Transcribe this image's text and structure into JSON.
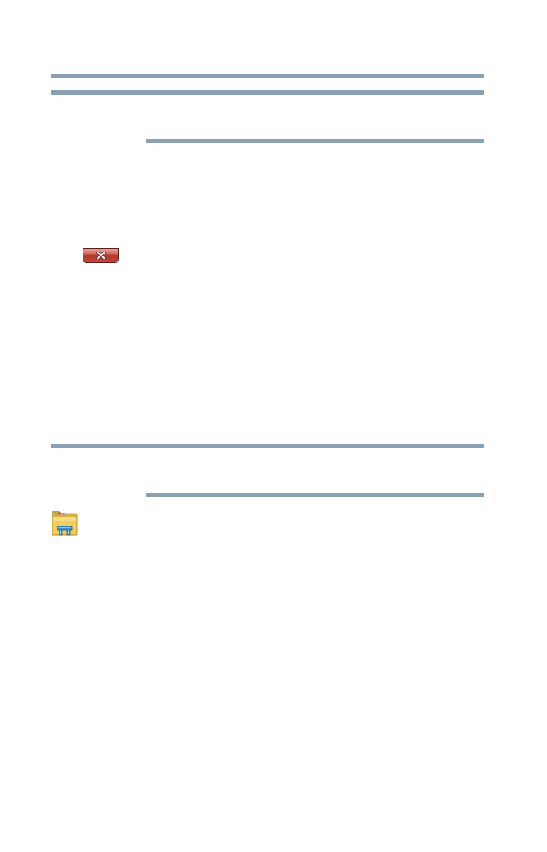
{
  "colors": {
    "rule": "#8aa0b4",
    "close_button": "#c6463a",
    "folder": "#f2cf5c"
  },
  "icons": {
    "close": "close-window-icon",
    "file_explorer": "file-explorer-icon"
  }
}
